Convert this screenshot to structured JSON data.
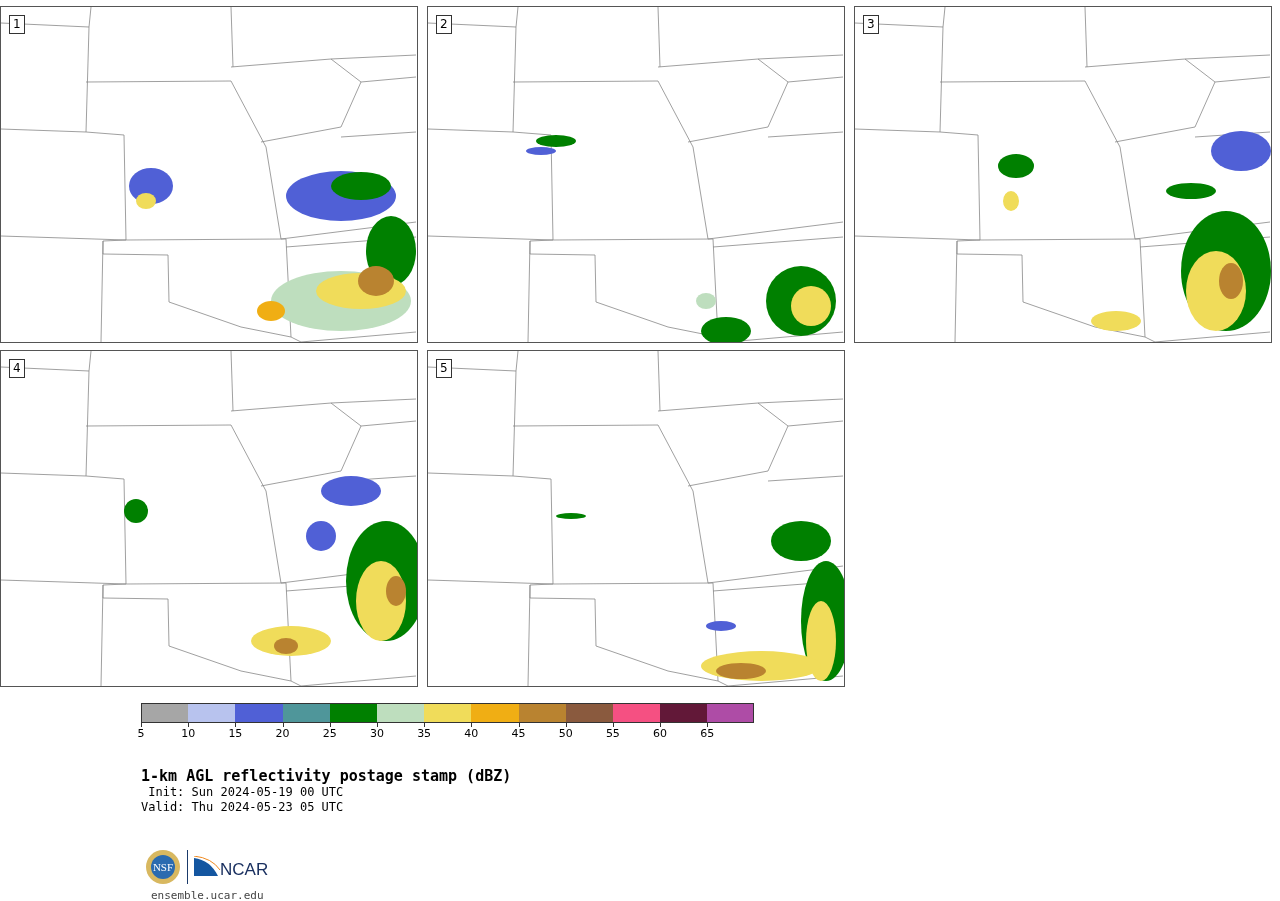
{
  "panels": [
    {
      "label": "1"
    },
    {
      "label": "2"
    },
    {
      "label": "3"
    },
    {
      "label": "4"
    },
    {
      "label": "5"
    }
  ],
  "colorbar": {
    "swatches": [
      {
        "color": "#a6a6a6"
      },
      {
        "color": "#b8c3ee"
      },
      {
        "color": "#5060d6"
      },
      {
        "color": "#4f969a"
      },
      {
        "color": "#008000"
      },
      {
        "color": "#bedebe"
      },
      {
        "color": "#f0dc5a"
      },
      {
        "color": "#f0ae14"
      },
      {
        "color": "#b98330"
      },
      {
        "color": "#8a5a3e"
      },
      {
        "color": "#f55082"
      },
      {
        "color": "#621838"
      },
      {
        "color": "#ae4ca6"
      }
    ],
    "ticks": [
      "5",
      "10",
      "15",
      "20",
      "25",
      "30",
      "35",
      "40",
      "45",
      "50",
      "55",
      "60",
      "65"
    ]
  },
  "title": "1-km AGL reflectivity postage stamp (dBZ)",
  "init": " Init: Sun 2024-05-19 00 UTC",
  "valid": "Valid: Thu 2024-05-23 05 UTC",
  "logos": {
    "nsf": "NSF",
    "ncar": "NCAR"
  },
  "url": "ensemble.ucar.edu"
}
